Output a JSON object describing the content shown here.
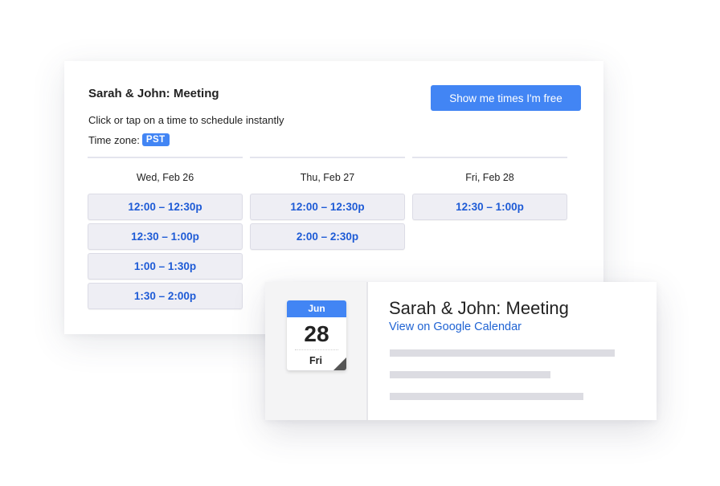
{
  "scheduler": {
    "title": "Sarah & John: Meeting",
    "free_button_label": "Show me times I'm free",
    "instructions": "Click or tap on a time to schedule instantly",
    "timezone_label": "Time zone:",
    "timezone_value": "PST",
    "days": [
      {
        "label": "Wed, Feb 26",
        "slots": [
          "12:00 – 12:30p",
          "12:30 – 1:00p",
          "1:00 – 1:30p",
          "1:30 – 2:00p"
        ]
      },
      {
        "label": "Thu, Feb 27",
        "slots": [
          "12:00 – 12:30p",
          "2:00 – 2:30p"
        ]
      },
      {
        "label": "Fri, Feb 28",
        "slots": [
          "12:30 – 1:00p"
        ]
      }
    ]
  },
  "event": {
    "calendar_icon": {
      "month": "Jun",
      "day": "28",
      "weekday": "Fri"
    },
    "title": "Sarah & John: Meeting",
    "link_label": "View on Google Calendar"
  },
  "colors": {
    "accent": "#4285f4",
    "slot_text": "#1e5bd6",
    "link": "#1f63d3"
  }
}
